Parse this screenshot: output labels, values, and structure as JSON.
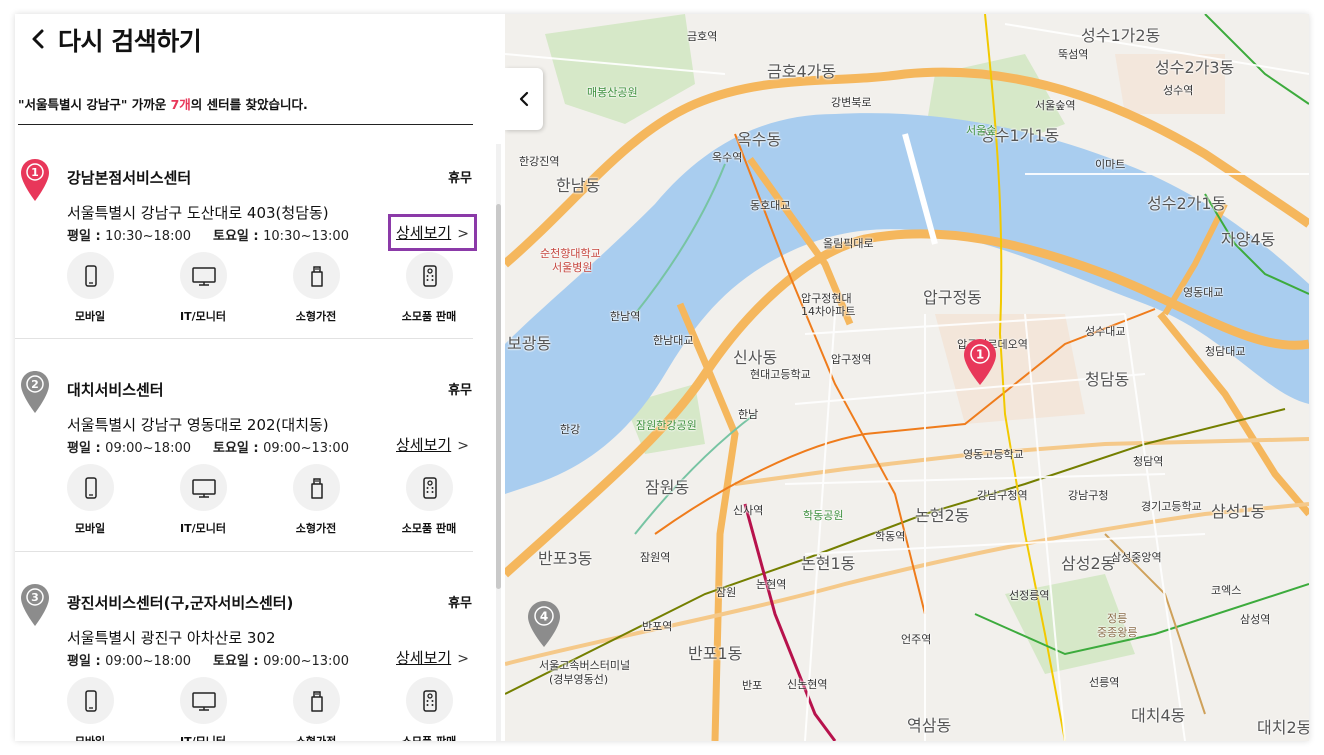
{
  "header": {
    "title": "다시 검색하기"
  },
  "result": {
    "prefix": "\"서울특별시 강남구\" 가까운 ",
    "count": "7개",
    "suffix": "의 센터를 찾았습니다."
  },
  "colors": {
    "accent": "#e8375a",
    "pin_gray": "#8c8c8c",
    "highlight": "#8b3aa8",
    "river": "#a9cdef",
    "road": "#f5b75d"
  },
  "hours_labels": {
    "weekday": "평일 : ",
    "saturday": "토요일 : "
  },
  "detail_label": "상세보기",
  "services": [
    {
      "label": "모바일",
      "icon": "mobile-icon"
    },
    {
      "label": "IT/모니터",
      "icon": "monitor-icon"
    },
    {
      "label": "소형가전",
      "icon": "small-appliance-icon"
    },
    {
      "label": "소모품 판매",
      "icon": "consumables-icon"
    }
  ],
  "centers": [
    {
      "number": "1",
      "name": "강남본점서비스센터",
      "status": "휴무",
      "address": "서울특별시 강남구 도산대로 403(청담동)",
      "weekday": "10:30~18:00",
      "saturday": "10:30~13:00"
    },
    {
      "number": "2",
      "name": "대치서비스센터",
      "status": "휴무",
      "address": "서울특별시 강남구 영동대로 202(대치동)",
      "weekday": "09:00~18:00",
      "saturday": "09:00~13:00"
    },
    {
      "number": "3",
      "name": "광진서비스센터(구,군자서비스센터)",
      "status": "휴무",
      "address": "서울특별시 광진구 아차산로 302",
      "weekday": "09:00~18:00",
      "saturday": "09:00~13:00"
    }
  ],
  "map": {
    "pins": [
      "1",
      "4"
    ],
    "labels": {
      "hangang": "한강",
      "okbong": "옥수동",
      "geumho": "금호4가동",
      "hannam": "한남동",
      "apgujeong": "압구정동",
      "sinsa": "신사동",
      "cheongdam": "청담동",
      "jamwon": "잠원동",
      "nonhyeon2": "논현2동",
      "nonhyeon1": "논현1동",
      "banpo3": "반포3동",
      "banpo1": "반포1동",
      "samseong1": "삼성1동",
      "samseong2": "삼성2동",
      "seongsu1": "성수1가1동",
      "seongsu2": "성수2가1동",
      "seongsu22": "성수2가3동",
      "seongsu12": "성수1가2동",
      "jayang4": "자양4동",
      "daechi4": "대치4동",
      "daechi2": "대치2동",
      "yeoksam": "역삼동",
      "bogwang": "보광동",
      "apgujeong_station": "압구정역",
      "apgujeong_rodeo": "압구정로데오역",
      "cheongdam_station": "청담역",
      "gangnamgu_office": "강남구청역",
      "gangnamgu": "강남구청",
      "sinsa_station": "신사역",
      "hakdong": "학동역",
      "nonhyeon_station": "논현역",
      "banpo_station": "반포역",
      "jamwon_station": "잠원역",
      "sinnonhyeon": "신논현역",
      "eonju": "언주역",
      "seonjeongneung": "선정릉역",
      "seolleung": "선릉역",
      "samseong_station": "삼성역",
      "samseong_jungang": "삼성중앙역",
      "coex": "코엑스",
      "oksu_station": "옥수역",
      "geumho_station": "금호역",
      "hannam_station": "한남역",
      "seoulforest": "서울숲역",
      "ttukseom": "뚝섬역",
      "seongsu_station": "성수역",
      "hangangjin": "한강진역",
      "dongho_bridge": "동호대교",
      "seongsu_bridge": "성수대교",
      "yeongdong_bridge": "영동대교",
      "hannam_bridge": "한남대교",
      "cheongdam_bridge": "청담대교",
      "gangbyeon": "강변북로",
      "olympic": "올림픽대로",
      "hakdong_park": "학동공원",
      "jamwon_park": "잠원한강공원",
      "hyundai_hs": "현대고등학교",
      "yeongdong_hs": "영동고등학교",
      "express_terminal": "서울고속버스터미널",
      "express_terminal_sub": "(경부영동선)",
      "sunchunhyang": "순천향대학교",
      "sunchunhyang_sub": "서울병원",
      "maebongsan": "매봉산공원",
      "jeongneung": "정릉",
      "jeongneung_sub": "중종왕릉",
      "gyeonggi_hs": "경기고등학교",
      "emart": "이마트",
      "seoulforest_label": "서울숲",
      "hyundai_apt": "압구정현대",
      "hyundai_apt_sub": "14차아파트",
      "sinsa_hannam": "한남",
      "banpo_label": "반포",
      "jamwon_label": "잠원"
    }
  }
}
